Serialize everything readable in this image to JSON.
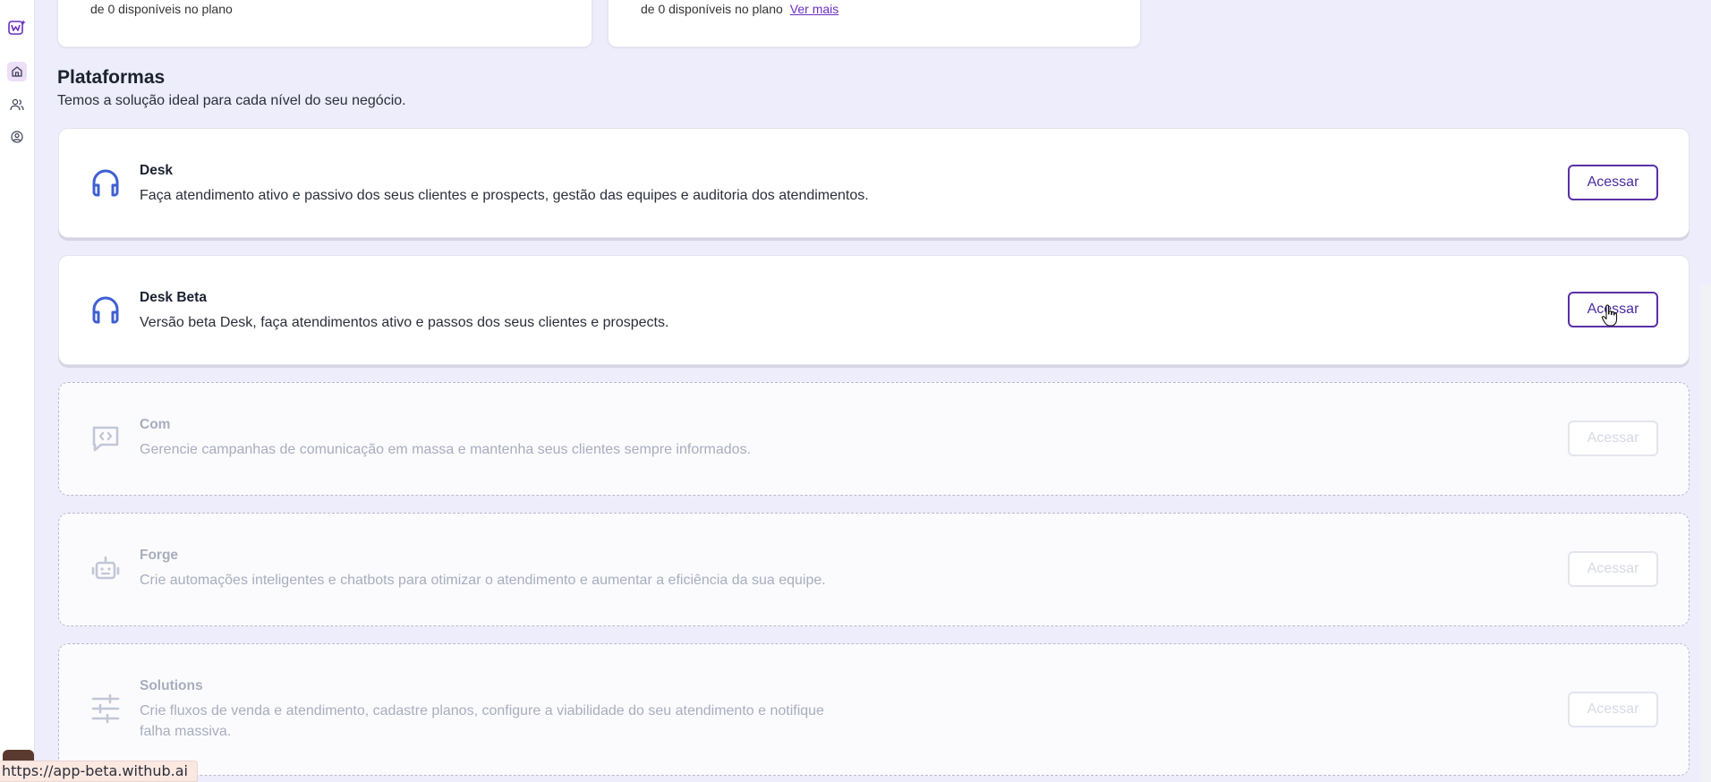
{
  "sidebar": {
    "items": [
      {
        "icon": "logo-icon",
        "active": false
      },
      {
        "icon": "home-icon",
        "active": true
      },
      {
        "icon": "users-icon",
        "active": false
      },
      {
        "icon": "user-circle-icon",
        "active": false
      }
    ]
  },
  "top_cards": [
    {
      "caption": "de 0 disponíveis no plano",
      "link": ""
    },
    {
      "caption": "de 0 disponíveis no plano",
      "link": "Ver mais"
    }
  ],
  "section": {
    "title": "Plataformas",
    "subtitle": "Temos a solução ideal para cada nível do seu negócio."
  },
  "platforms": [
    {
      "name": "Desk",
      "description": "Faça atendimento ativo e passivo dos seus clientes e prospects, gestão das equipes e auditoria dos atendimentos.",
      "button": "Acessar",
      "enabled": true,
      "icon": "headset-icon"
    },
    {
      "name": "Desk Beta",
      "description": "Versão beta Desk, faça atendimentos ativo e passos dos seus clientes e prospects.",
      "button": "Acessar",
      "enabled": true,
      "icon": "headset-icon"
    },
    {
      "name": "Com",
      "description": "Gerencie campanhas de comunicação em massa e mantenha seus clientes sempre informados.",
      "button": "Acessar",
      "enabled": false,
      "icon": "message-code-icon"
    },
    {
      "name": "Forge",
      "description": "Crie automações inteligentes e chatbots para otimizar o atendimento e aumentar a eficiência da sua equipe.",
      "button": "Acessar",
      "enabled": false,
      "icon": "robot-icon"
    },
    {
      "name": "Solutions",
      "description_line1": "Crie fluxos de venda e atendimento, cadastre planos, configure a viabilidade do seu atendimento e notifique",
      "description_line2": "falha massiva.",
      "button": "Acessar",
      "enabled": false,
      "icon": "sliders-icon"
    }
  ],
  "status_url": "https://app-beta.withub.ai",
  "colors": {
    "accent": "#5a2fa8",
    "icon_blue": "#3f5fd1",
    "background": "#ededfb"
  }
}
